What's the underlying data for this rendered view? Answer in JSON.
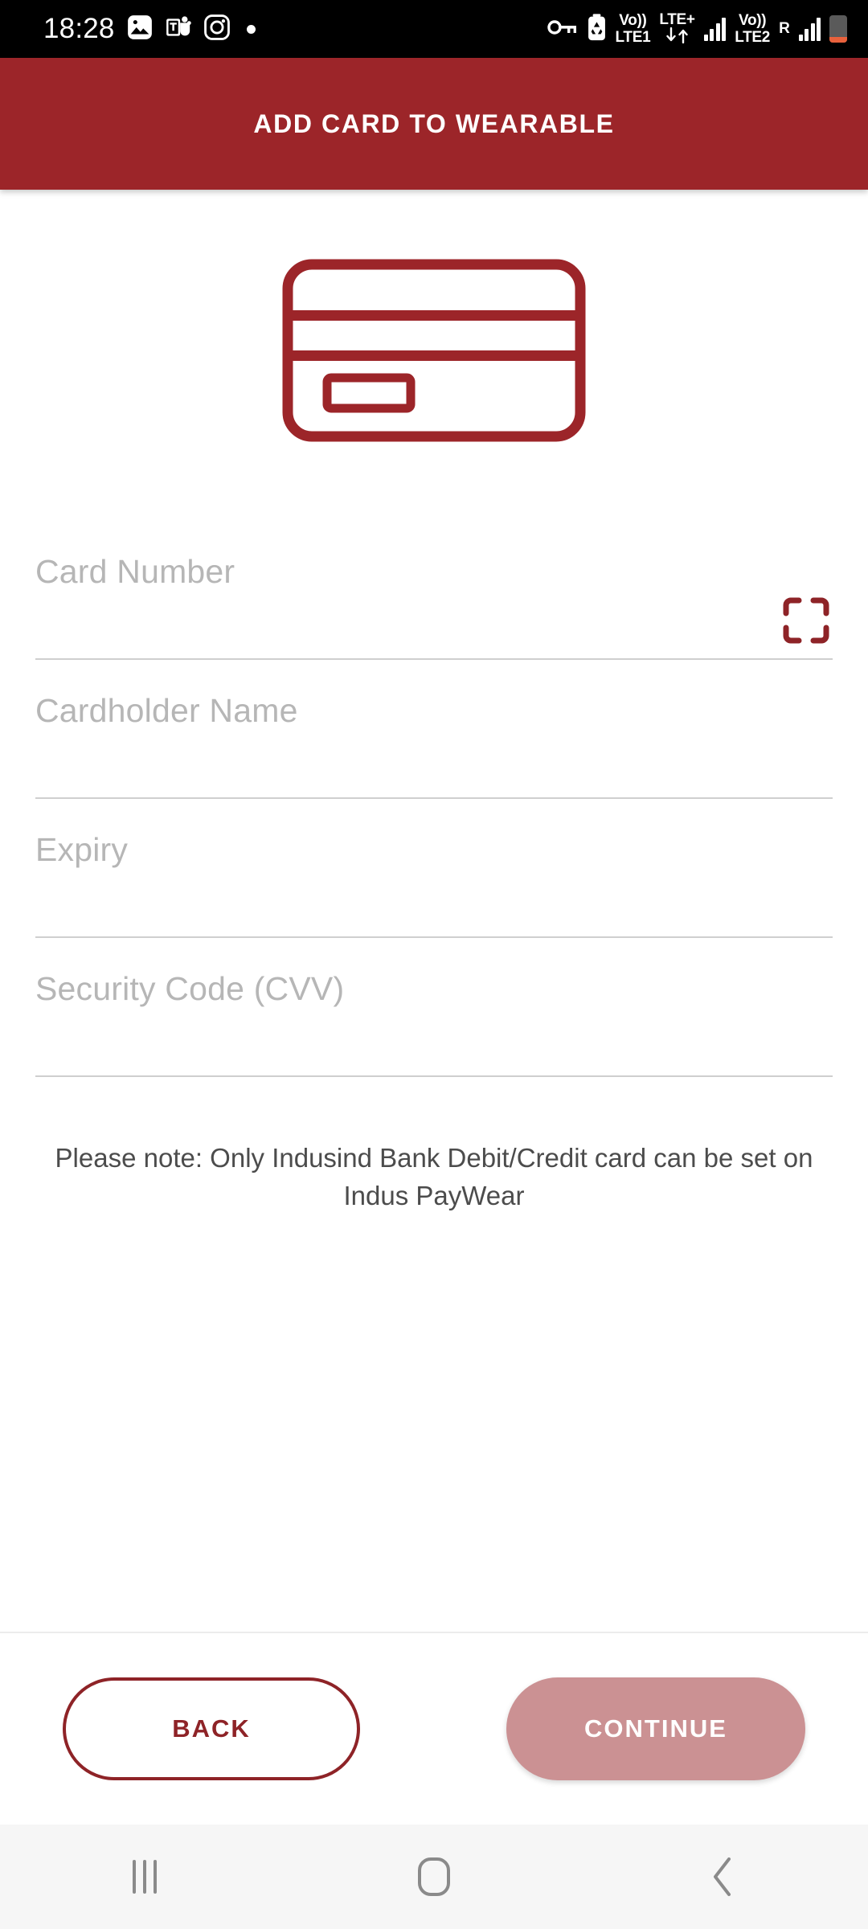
{
  "status_bar": {
    "time": "18:28",
    "left_icons": [
      "gallery-icon",
      "teams-icon",
      "instagram-icon",
      "dot-indicator"
    ],
    "right_icons": [
      "vpn-key-icon",
      "battery-saver-icon",
      "volte1-icon",
      "lte-plus-data-icon",
      "signal-bars-sim1-icon",
      "volte2-icon",
      "roaming-icon",
      "signal-bars-sim2-icon",
      "battery-low-icon"
    ],
    "sim1_volte": "Vo))",
    "sim1_label": "LTE1",
    "network_type": "LTE+",
    "sim2_volte": "Vo))",
    "sim2_label": "LTE2",
    "roaming": "R"
  },
  "header": {
    "title": "ADD CARD TO WEARABLE",
    "bg_color": "#9c2529",
    "text_color": "#ffffff"
  },
  "card_illustration": {
    "name": "credit-card-illustration",
    "stroke_color": "#9c2529"
  },
  "form": {
    "fields": [
      {
        "name": "card-number-field",
        "placeholder": "Card Number",
        "value": "",
        "has_scan_button": true
      },
      {
        "name": "cardholder-name-field",
        "placeholder": "Cardholder Name",
        "value": "",
        "has_scan_button": false
      },
      {
        "name": "expiry-field",
        "placeholder": "Expiry",
        "value": "",
        "has_scan_button": false
      },
      {
        "name": "cvv-field",
        "placeholder": "Security Code (CVV)",
        "value": "",
        "has_scan_button": false
      }
    ],
    "scan_icon": "scan-card-icon",
    "scan_icon_color": "#8e2327",
    "placeholder_color": "#b6b6b6"
  },
  "note": {
    "text": "Please note: Only Indusind Bank Debit/Credit card can be set on Indus PayWear"
  },
  "footer": {
    "back_label": "BACK",
    "back_color": "#8e2327",
    "continue_label": "CONTINUE",
    "continue_bg": "#cb9193",
    "continue_text_color": "#ffffff"
  },
  "nav_bar": {
    "items": [
      {
        "name": "nav-recents-button",
        "icon": "recents-icon"
      },
      {
        "name": "nav-home-button",
        "icon": "home-icon"
      },
      {
        "name": "nav-back-button",
        "icon": "back-chevron-icon"
      }
    ]
  }
}
